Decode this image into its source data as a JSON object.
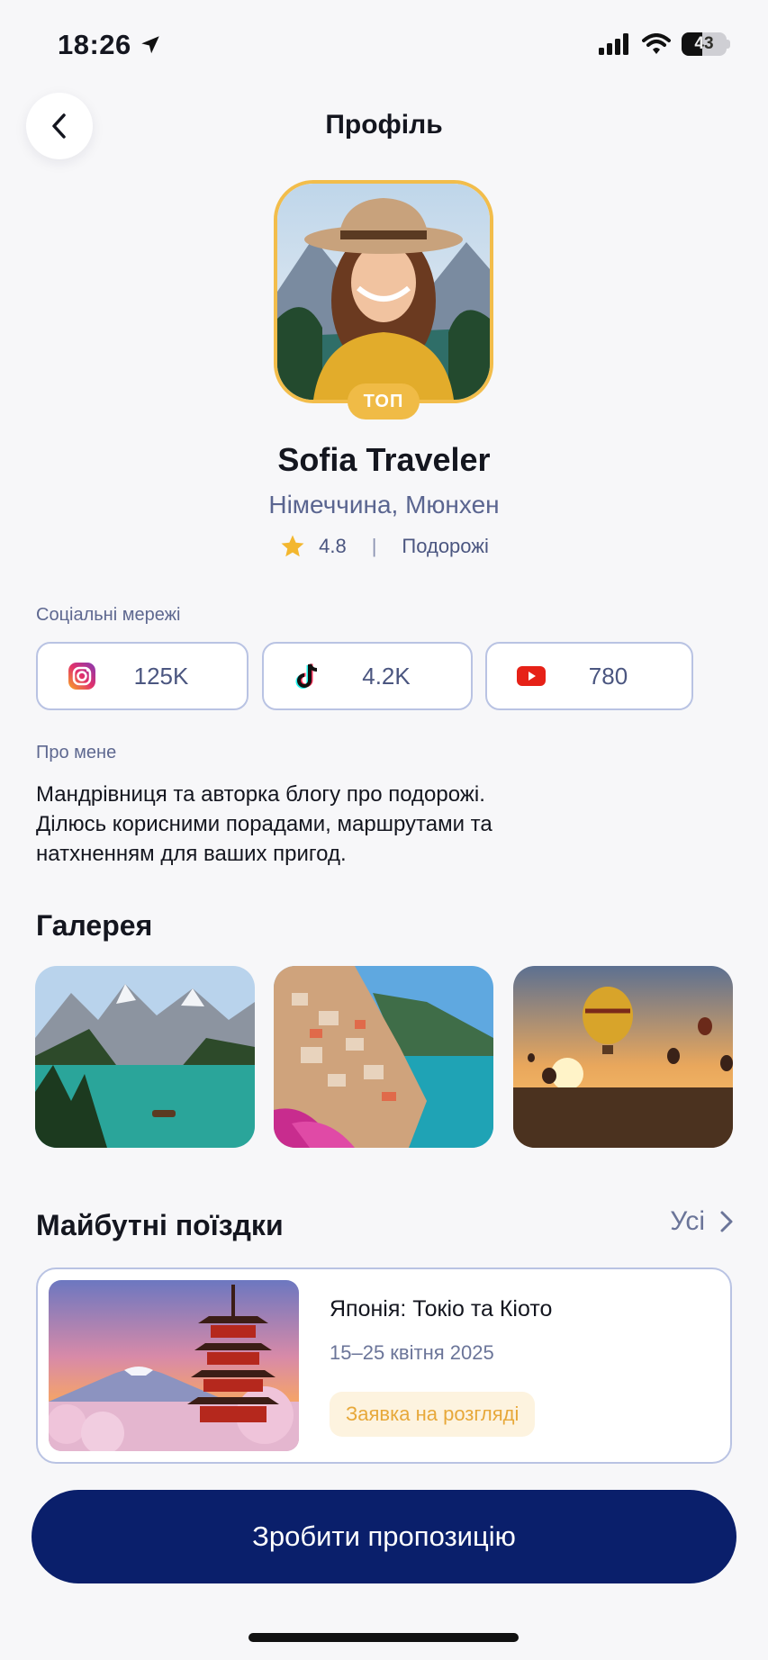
{
  "status_bar": {
    "time": "18:26",
    "battery": "43"
  },
  "header": {
    "title": "Профіль"
  },
  "profile": {
    "badge": "ТОП",
    "name": "Sofia Traveler",
    "location": "Німеччина, Мюнхен",
    "rating": "4.8",
    "separator": "|",
    "category": "Подорожі"
  },
  "social": {
    "label": "Соціальні мережі",
    "items": [
      {
        "icon": "instagram-icon",
        "count": "125K"
      },
      {
        "icon": "tiktok-icon",
        "count": "4.2K"
      },
      {
        "icon": "youtube-icon",
        "count": "780"
      }
    ]
  },
  "about": {
    "label": "Про мене",
    "lines": [
      "Мандрівниця та авторка блогу про подорожі.",
      "Ділюсь корисними порадами, маршрутами та",
      "натхненням для ваших пригод."
    ]
  },
  "gallery": {
    "title": "Галерея",
    "images": [
      "mountain-lake-photo",
      "coastal-village-photo",
      "hot-air-balloons-photo"
    ]
  },
  "trips": {
    "title": "Майбутні поїздки",
    "see_all": "Усі",
    "items": [
      {
        "title": "Японія: Токіо та Кіото",
        "dates": "15–25 квітня 2025",
        "status": "Заявка на розгляді",
        "image": "japan-pagoda-photo"
      }
    ]
  },
  "cta": {
    "label": "Зробити пропозицію"
  },
  "colors": {
    "accent_gold": "#f0bb46",
    "primary_navy": "#0a1f6b",
    "border_blue": "#b9c3e3",
    "status_bg": "#fdf3df",
    "status_text": "#e7a83a"
  }
}
